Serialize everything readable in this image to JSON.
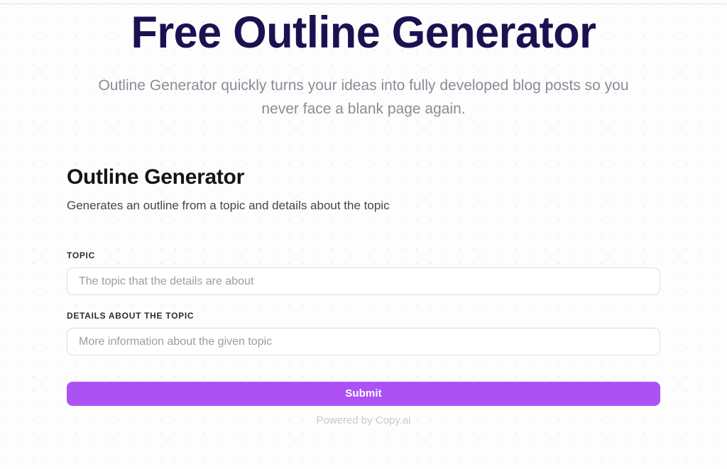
{
  "page": {
    "background_color": "#fdfdfe",
    "dot_color": "#ececed"
  },
  "hero": {
    "title": "Free Outline Generator",
    "title_color": "#1b1151",
    "subtitle": "Outline Generator quickly turns your ideas into fully developed blog posts so you never face a blank page again."
  },
  "form": {
    "title": "Outline Generator",
    "description": "Generates an outline from a topic and details about the topic",
    "fields": [
      {
        "label": "TOPIC",
        "placeholder": "The topic that the details are about",
        "value": ""
      },
      {
        "label": "DETAILS ABOUT THE TOPIC",
        "placeholder": "More information about the given topic",
        "value": ""
      }
    ],
    "submit_label": "Submit",
    "submit_color": "#ac52f5",
    "powered_by": "Powered by Copy.ai"
  }
}
